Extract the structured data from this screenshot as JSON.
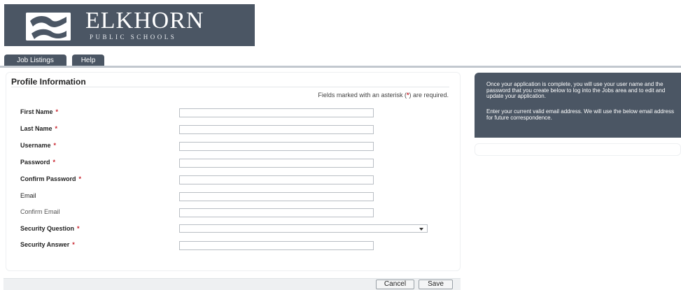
{
  "logo": {
    "name": "ELKHORN",
    "subtitle": "PUBLIC SCHOOLS"
  },
  "tabs": [
    {
      "label": "Job Listings"
    },
    {
      "label": "Help"
    }
  ],
  "form": {
    "title": "Profile Information",
    "required_note_prefix": "Fields marked with an asterisk (",
    "required_note_mark": "*",
    "required_note_suffix": ") are required.",
    "required_mark": "*",
    "fields": {
      "first_name": {
        "label": "First Name",
        "value": ""
      },
      "last_name": {
        "label": "Last Name",
        "value": ""
      },
      "username": {
        "label": "Username",
        "value": ""
      },
      "password": {
        "label": "Password",
        "value": ""
      },
      "confirm_password": {
        "label": "Confirm Password",
        "value": ""
      },
      "email": {
        "label": "Email",
        "value": ""
      },
      "confirm_email": {
        "label": "Confirm Email",
        "value": ""
      },
      "security_question": {
        "label": "Security Question",
        "value": ""
      },
      "security_answer": {
        "label": "Security Answer",
        "value": ""
      }
    }
  },
  "actions": {
    "cancel_label": "Cancel",
    "save_label": "Save"
  },
  "info": {
    "paragraph1": "Once your application is complete, you will use your user name and the password that you create below to log into the Jobs area and to edit and update your application.",
    "paragraph2": "Enter your current valid email address. We will use the below email address for future correspondence."
  },
  "colors": {
    "brand": "#4b5664",
    "required": "#c8202a"
  }
}
